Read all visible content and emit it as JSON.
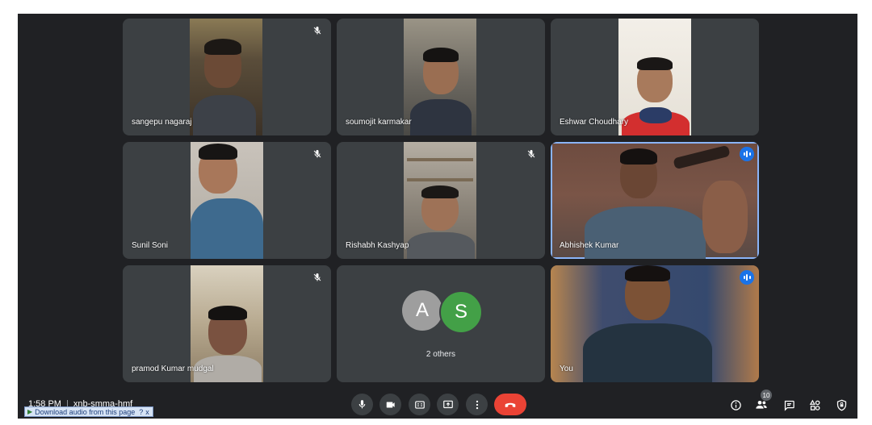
{
  "participants": [
    {
      "name": "sangepu nagaraj",
      "muted": true
    },
    {
      "name": "soumojit karmakar",
      "muted": false
    },
    {
      "name": "Eshwar Choudhary",
      "muted": false
    },
    {
      "name": "Sunil Soni",
      "muted": true
    },
    {
      "name": "Rishabh Kashyap",
      "muted": true
    },
    {
      "name": "Abhishek Kumar",
      "speaking": true
    },
    {
      "name": "pramod Kumar mudgal",
      "muted": true
    },
    {
      "name": "You",
      "speaking": true
    }
  ],
  "others": {
    "avatars": [
      {
        "letter": "A",
        "color": "#9e9e9e"
      },
      {
        "letter": "S",
        "color": "#43a047"
      }
    ],
    "label": "2 others"
  },
  "meeting": {
    "time": "1:58 PM",
    "code": "xnb-smma-hmf"
  },
  "download_bar": {
    "label": "Download audio from this page",
    "help": "?",
    "close": "x"
  },
  "controls": [
    "mic-icon",
    "camera-icon",
    "captions-icon",
    "present-icon",
    "more-options-icon",
    "end-call-icon"
  ],
  "right_icons": [
    "info-icon",
    "people-icon",
    "chat-icon",
    "activities-icon",
    "host-controls-icon"
  ],
  "people_count": "10",
  "colors": {
    "bg": "#202124",
    "tile": "#3c4043",
    "end_call": "#ea4335",
    "speaking": "#1a73e8"
  }
}
